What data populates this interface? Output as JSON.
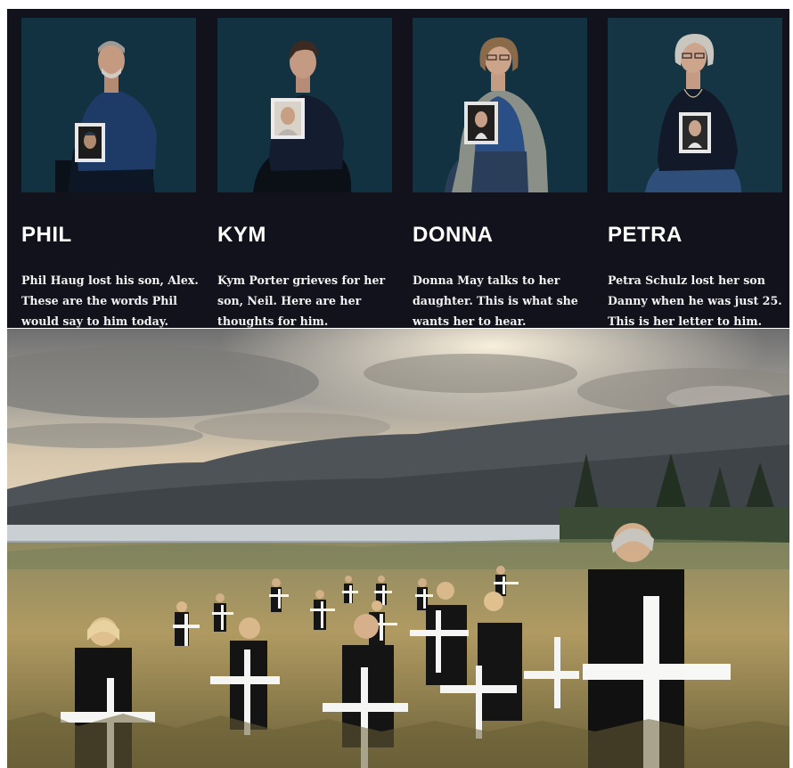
{
  "people": [
    {
      "name": "PHIL",
      "text": "Phil Haug lost his son, Alex. These are the words Phil would say to him today.",
      "icon": "portrait-phil"
    },
    {
      "name": "KYM",
      "text": "Kym Porter grieves for her son, Neil. Here are her thoughts for him.",
      "icon": "portrait-kym"
    },
    {
      "name": "DONNA",
      "text": "Donna May talks to her daughter. This is what she wants her to hear.",
      "icon": "portrait-donna"
    },
    {
      "name": "PETRA",
      "text": "Petra Schulz lost her son Danny when he was just 25. This is her letter to him.",
      "icon": "portrait-petra"
    }
  ],
  "colors": {
    "panel": "#11121b",
    "name": "#ffffff",
    "text": "#f2f2f2",
    "photo_bg": "#123240"
  },
  "scene": {
    "icon": "field-of-white-crosses-photo"
  }
}
